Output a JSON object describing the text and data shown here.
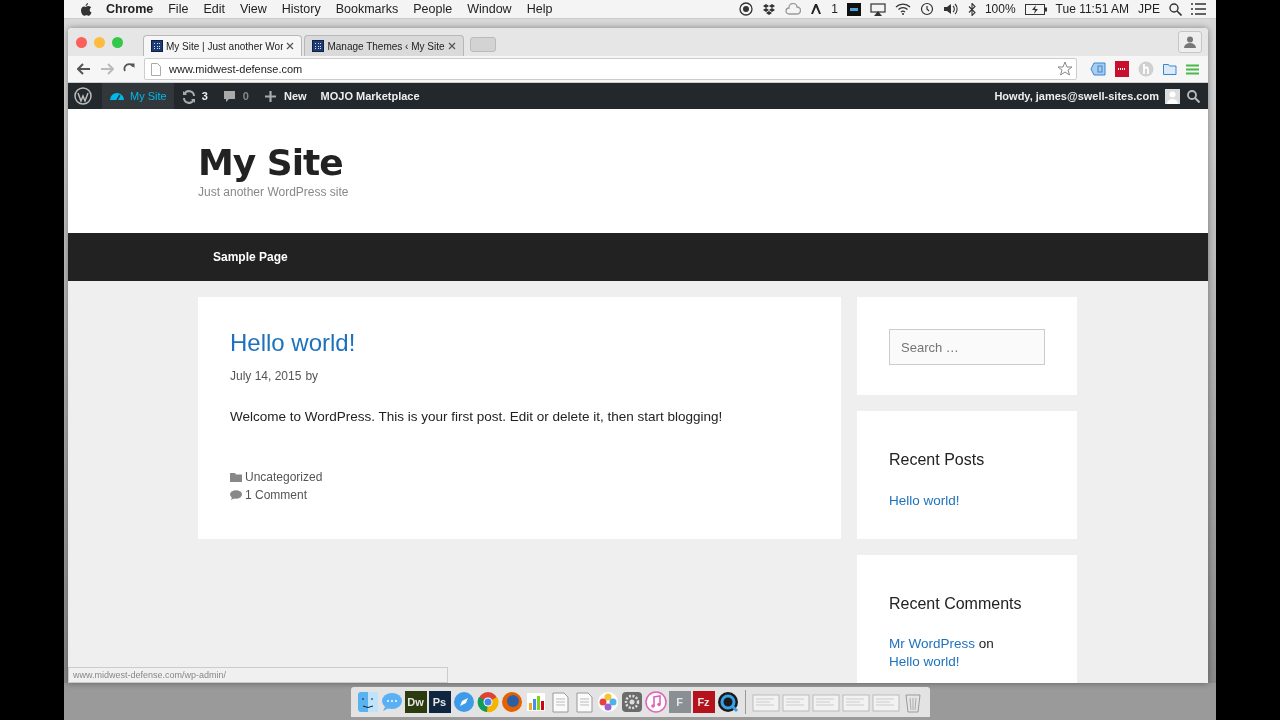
{
  "menu_bar": {
    "app": "Chrome",
    "menus": [
      "File",
      "Edit",
      "View",
      "History",
      "Bookmarks",
      "People",
      "Window",
      "Help"
    ],
    "adobe_count": "1",
    "battery": "100%",
    "clock": "Tue 11:51 AM",
    "user": "JPE"
  },
  "browser": {
    "tabs": [
      {
        "title": "My Site | Just another Wor",
        "selected": true
      },
      {
        "title": "Manage Themes ‹ My Site",
        "selected": false
      }
    ],
    "address": "www.midwest-defense.com",
    "status_url": "www.midwest-defense.com/wp-admin/"
  },
  "admin_bar": {
    "items": [
      {
        "kind": "site",
        "label": "My Site",
        "selected": true
      },
      {
        "kind": "updates",
        "label": "3",
        "selected": false
      },
      {
        "kind": "comments",
        "label": "0",
        "selected": false
      },
      {
        "kind": "new",
        "label": "New",
        "selected": false
      },
      {
        "kind": "plain",
        "label": "MOJO Marketplace",
        "selected": false
      }
    ],
    "account": "Howdy, james@swell-sites.com"
  },
  "site": {
    "title": "My Site",
    "tagline": "Just another WordPress site",
    "nav": [
      "Sample Page"
    ],
    "post": {
      "title": "Hello world!",
      "date": "July 14, 2015",
      "byline": "by",
      "content": "Welcome to WordPress. This is your first post. Edit or delete it, then start blogging!",
      "category": "Uncategorized",
      "comments": "1 Comment"
    },
    "search_placeholder": "Search …",
    "recent_posts": {
      "heading": "Recent Posts",
      "items": [
        "Hello world!"
      ]
    },
    "recent_comments": {
      "heading": "Recent Comments",
      "author": "Mr WordPress",
      "on": "on",
      "post": "Hello world!"
    }
  },
  "dock": [
    {
      "kind": "finder"
    },
    {
      "kind": "messages"
    },
    {
      "kind": "label",
      "label": "Dw",
      "color": "#2b3a0f"
    },
    {
      "kind": "label",
      "label": "Ps",
      "color": "#10253f"
    },
    {
      "kind": "safari"
    },
    {
      "kind": "chrome"
    },
    {
      "kind": "firefox"
    },
    {
      "kind": "chart"
    },
    {
      "kind": "doc"
    },
    {
      "kind": "doc"
    },
    {
      "kind": "photos"
    },
    {
      "kind": "gear"
    },
    {
      "kind": "music"
    },
    {
      "kind": "label",
      "label": "F",
      "color": "#8a8f94"
    },
    {
      "kind": "label",
      "label": "Fz",
      "color": "#b5121b"
    },
    {
      "kind": "quicktime"
    },
    {
      "kind": "thumb"
    },
    {
      "kind": "thumb"
    },
    {
      "kind": "thumb"
    },
    {
      "kind": "thumb"
    },
    {
      "kind": "thumb"
    },
    {
      "kind": "trash"
    }
  ]
}
